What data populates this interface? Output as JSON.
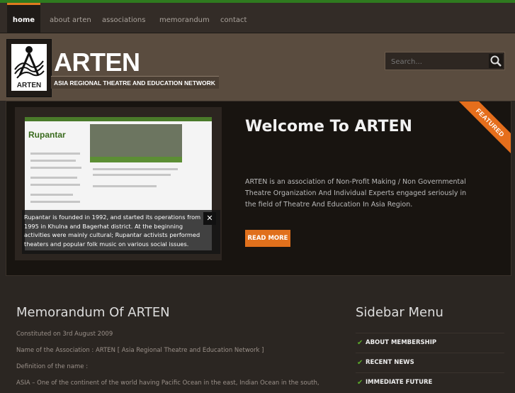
{
  "nav": {
    "items": [
      {
        "label": "home",
        "active": true
      },
      {
        "label": "about arten"
      },
      {
        "label": "associations"
      },
      {
        "label": "memorandum"
      },
      {
        "label": "contact"
      }
    ]
  },
  "header": {
    "logo_text": "ARTEN",
    "title": "ARTEN",
    "subtitle": "ASIA REGIONAL THEATRE AND EDUCATION NETWORK",
    "search_placeholder": "Search..."
  },
  "featured": {
    "ribbon": "FEATURED",
    "title": "Welcome To ARTEN",
    "description": "ARTEN is an association of Non-Profit Making / Non Governmental Theatre Organization And Individual Experts engaged seriously in the field of Theatre And Education In Asia Region.",
    "read_more": "READ MORE",
    "slide": {
      "screenshot_title": "Rupantar",
      "caption": "Rupantar is founded in 1992, and started its operations from 1995 in Khulna and Bagerhat district. At the beginning activities were mainly cultural; Rupantar activists performed theaters and popular folk music on various social issues.",
      "close": "✕"
    }
  },
  "main": {
    "title": "Memorandum Of ARTEN",
    "paragraphs": [
      "Constituted on 3rd August 2009",
      "Name of the Association : ARTEN [ Asia Regional Theatre and Education Network ]",
      "Definition of the name :",
      "ASIA – One of the continent of the world having Pacific Ocean in the east, Indian Ocean in the south,"
    ]
  },
  "sidebar": {
    "title": "Sidebar Menu",
    "items": [
      "ABOUT MEMBERSHIP",
      "RECENT NEWS",
      "IMMEDIATE FUTURE"
    ]
  },
  "colors": {
    "accent": "#e0701c",
    "top_line": "#2f7a1f",
    "header_bg": "#5a4c3f"
  }
}
